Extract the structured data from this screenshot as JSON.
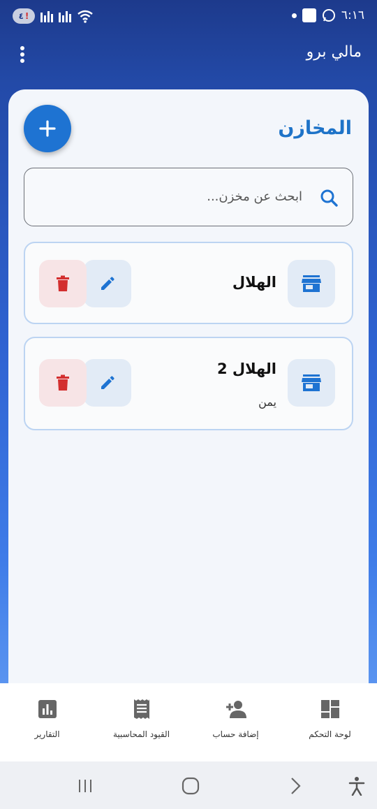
{
  "status_bar": {
    "time": "٦:١٦",
    "battery_badge": "٤",
    "battery_warning": "!"
  },
  "app_bar": {
    "title": "مالي برو"
  },
  "page": {
    "title": "المخازن"
  },
  "search": {
    "placeholder": "ابحث عن مخزن..."
  },
  "warehouses": [
    {
      "name": "الهلال",
      "subtitle": ""
    },
    {
      "name": "الهلال 2",
      "subtitle": "يمن"
    }
  ],
  "bottom_nav": {
    "items": [
      {
        "label": "لوحة التحكم",
        "icon": "dashboard-icon"
      },
      {
        "label": "إضافة حساب",
        "icon": "person-add-icon"
      },
      {
        "label": "القيود المحاسبية",
        "icon": "receipt-icon"
      },
      {
        "label": "التقارير",
        "icon": "bar-chart-icon"
      }
    ]
  },
  "colors": {
    "primary": "#1e73d2",
    "title_blue": "#1e73c8",
    "delete_red": "#d32f2f",
    "header_blue": "#1d3a8c"
  }
}
